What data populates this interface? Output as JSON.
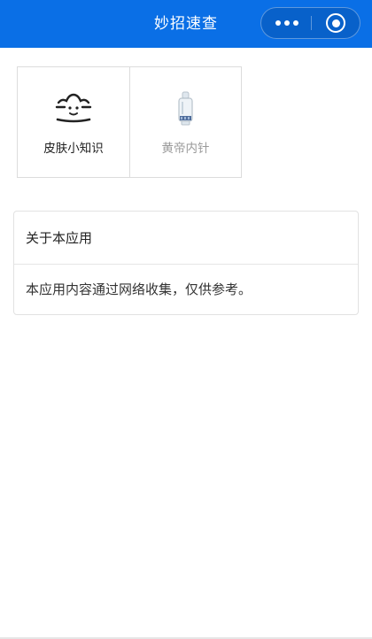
{
  "navbar": {
    "title": "妙招速查",
    "background": "#0a6fe6",
    "capsule": {
      "more_icon": "more-dots-icon",
      "close_icon": "target-icon"
    }
  },
  "grid": {
    "items": [
      {
        "label": "皮肤小知识",
        "icon": "skin-face-icon",
        "enabled": true
      },
      {
        "label": "黄帝内针",
        "icon": "tube-icon",
        "enabled": false
      }
    ]
  },
  "about_card": {
    "title": "关于本应用",
    "body": "本应用内容通过网络收集，仅供参考。"
  }
}
